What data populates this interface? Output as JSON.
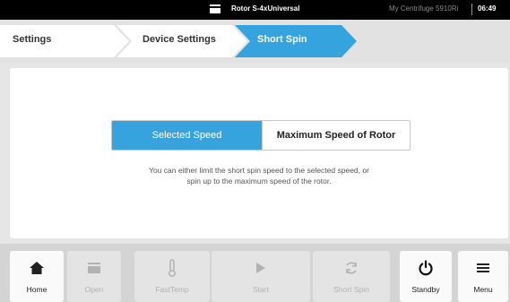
{
  "status_bar": {
    "rotor_icon": "rotor-icon",
    "rotor_name": "Rotor S-4xUniversal",
    "device_name": "My Centrifuge 5910Ri",
    "time": "06:49"
  },
  "breadcrumb": {
    "items": [
      {
        "label": "Settings",
        "active": false
      },
      {
        "label": "Device Settings",
        "active": false
      },
      {
        "label": "Short Spin",
        "active": true
      }
    ]
  },
  "short_spin": {
    "options": [
      {
        "label": "Selected Speed",
        "selected": true
      },
      {
        "label": "Maximum Speed of Rotor",
        "selected": false
      }
    ],
    "help_lines": [
      "You can either limit the short spin speed to the selected speed, or",
      "spin up to the maximum speed of the rotor."
    ]
  },
  "toolbar": {
    "buttons": [
      {
        "label": "Home",
        "icon": "home-icon",
        "enabled": true
      },
      {
        "label": "Open",
        "icon": "lid-open-icon",
        "enabled": false
      },
      {
        "label": "FastTemp",
        "icon": "thermometer-icon",
        "enabled": false
      },
      {
        "label": "Start",
        "icon": "play-icon",
        "enabled": false
      },
      {
        "label": "Short Spin",
        "icon": "short-spin-icon",
        "enabled": false
      },
      {
        "label": "Standby",
        "icon": "power-icon",
        "enabled": true
      },
      {
        "label": "Menu",
        "icon": "hamburger-menu-icon",
        "enabled": true
      }
    ]
  },
  "colors": {
    "accent": "#35a3dd",
    "status_bar": "#000000",
    "toolbar": "#d4d4d4",
    "disabled_text": "#b2b2b2"
  }
}
